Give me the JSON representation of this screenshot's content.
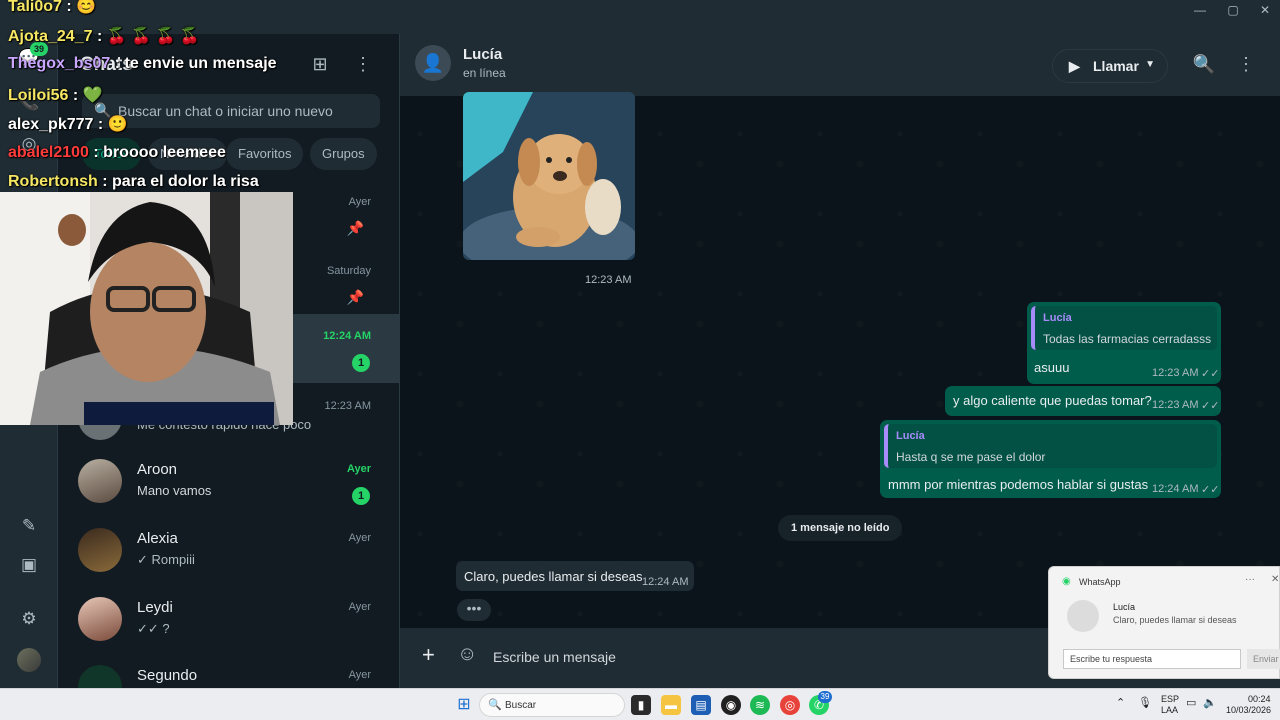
{
  "window": {
    "title": "WhatsApp"
  },
  "sidebar": {
    "title": "Chats",
    "search_placeholder": "Buscar un chat o iniciar uno nuevo",
    "filters": [
      "Todos",
      "No leídos",
      "Favoritos",
      "Grupos"
    ],
    "rail_badge": "39",
    "chats": [
      {
        "name": "",
        "preview": "",
        "time": "Ayer",
        "pinned": true
      },
      {
        "name": "",
        "preview": "",
        "time": "Saturday",
        "pinned": true
      },
      {
        "name": "",
        "preview": "",
        "time": "12:24 AM",
        "unread": "1"
      },
      {
        "name": "",
        "preview": "Me contestó rápido hace poco",
        "time": "12:23 AM"
      },
      {
        "name": "Aroon",
        "preview": "Mano vamos",
        "time": "Ayer",
        "unread": "1"
      },
      {
        "name": "Alexia",
        "preview": "✓ Rompiii",
        "time": "Ayer"
      },
      {
        "name": "Leydi",
        "preview": "✓✓ ?",
        "time": "Ayer"
      },
      {
        "name": "Segundo",
        "preview": "",
        "time": "Ayer"
      }
    ]
  },
  "conversation": {
    "contact_name": "Lucía",
    "status": "en línea",
    "call_label": "Llamar",
    "image_time": "12:23 AM",
    "messages_out": [
      {
        "quote_name": "Lucía",
        "quote_text": "Todas las farmacias cerradasss",
        "text": "asuuu",
        "time": "12:23 AM"
      },
      {
        "text": "y algo caliente que puedas tomar?",
        "time": "12:23 AM"
      },
      {
        "quote_name": "Lucía",
        "quote_text": "Hasta q se me pase el dolor",
        "text": "mmm por mientras podemos hablar si gustas",
        "time": "12:24 AM"
      }
    ],
    "unread_divider": "1 mensaje no leído",
    "incoming": {
      "text": "Claro, puedes llamar si deseas",
      "time": "12:24 AM"
    },
    "typing": "•••",
    "composer_placeholder": "Escribe un mensaje"
  },
  "notification": {
    "app": "WhatsApp",
    "sender": "Lucía",
    "message": "Claro, puedes llamar si deseas",
    "reply_placeholder": "Escribe tu respuesta",
    "send_label": "Enviar",
    "more": "···",
    "close": "✕"
  },
  "stream_overlay": [
    {
      "user": "Tali0o7",
      "msg": " : 😊",
      "color": "#f5e663"
    },
    {
      "user": "Ajota_24_7",
      "msg": " : 🍒 🍒 🍒 🍒",
      "color": "#f5e663"
    },
    {
      "user": "Thegox_bs07",
      "msg": " : te envie un mensaje",
      "color": "#c9a6ff"
    },
    {
      "user": "Loiloi56",
      "msg": " : 💚",
      "color": "#f5e663"
    },
    {
      "user": "alex_pk777",
      "msg": " : 🙂",
      "color": "#ffffff"
    },
    {
      "user": "abalel2100",
      "msg": " : broooo leemeee",
      "color": "#ff3b3b"
    },
    {
      "user": "Robertonsh",
      "msg": " : para el dolor la risa",
      "color": "#f5e663"
    }
  ],
  "taskbar": {
    "search_label": "Buscar",
    "whatsapp_badge": "39",
    "lang_top": "ESP",
    "lang_bottom": "LAA",
    "time": "00:24",
    "date": "10/03/2026"
  }
}
